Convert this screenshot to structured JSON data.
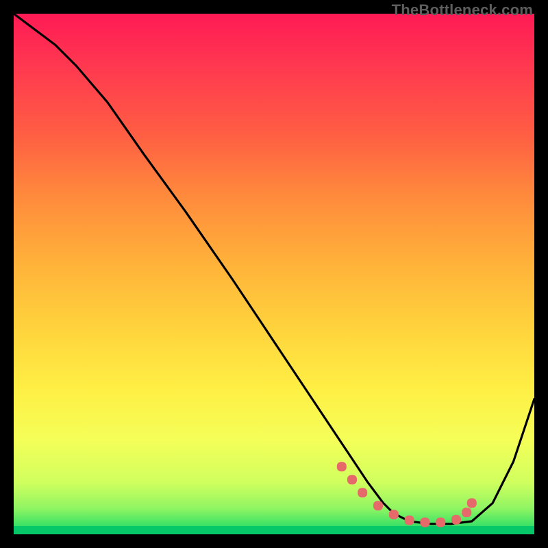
{
  "watermark": "TheBottleneck.com",
  "chart_data": {
    "type": "line",
    "title": "",
    "xlabel": "",
    "ylabel": "",
    "xlim": [
      0,
      100
    ],
    "ylim": [
      0,
      100
    ],
    "grid": false,
    "legend": false,
    "background_gradient": {
      "top_color": "#ff1a4d",
      "mid_colors": [
        "#ff6a3c",
        "#ffb23a",
        "#ffe23e",
        "#f8ff60",
        "#c8ff66"
      ],
      "bottom_color": "#05e070",
      "bottom_band_color": "#07c868"
    },
    "series": [
      {
        "name": "curve",
        "color": "#000000",
        "x": [
          0,
          4,
          8,
          12,
          18,
          25,
          33,
          42,
          50,
          58,
          64,
          68,
          71,
          73,
          76,
          80,
          84,
          88,
          92,
          96,
          100
        ],
        "y": [
          100,
          97,
          94,
          90,
          83,
          73,
          62,
          49,
          37,
          25,
          16,
          10,
          6,
          4,
          2.5,
          2,
          2,
          2.5,
          6,
          14,
          26
        ]
      }
    ],
    "markers": {
      "name": "highlight-dots",
      "color": "#e66a6a",
      "shape": "rounded",
      "x": [
        63,
        65,
        67,
        70,
        73,
        76,
        79,
        82,
        85,
        87,
        88
      ],
      "y": [
        13,
        10.5,
        8,
        5.5,
        3.8,
        2.7,
        2.3,
        2.3,
        2.8,
        4.2,
        6
      ]
    }
  }
}
